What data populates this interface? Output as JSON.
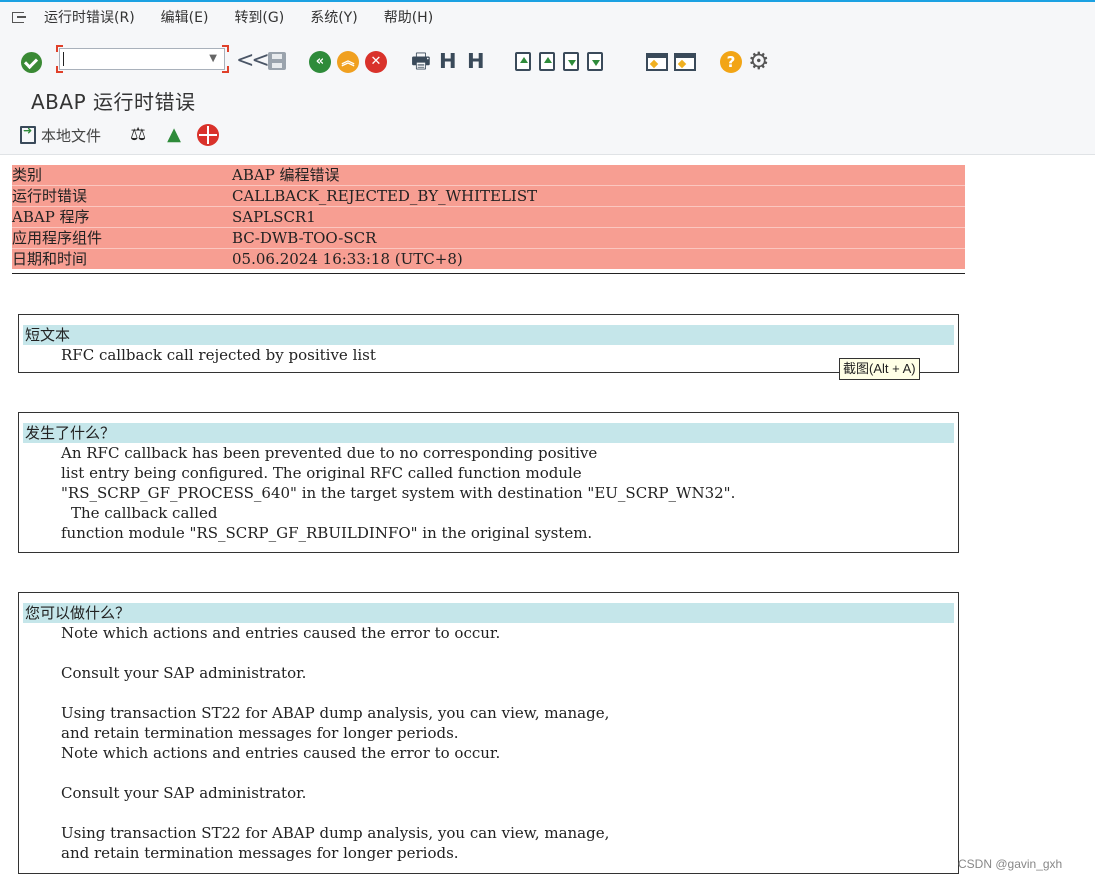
{
  "menu": {
    "items": [
      "运行时错误(R)",
      "编辑(E)",
      "转到(G)",
      "系统(Y)",
      "帮助(H)"
    ]
  },
  "toolbar": {
    "command_value": "",
    "icons": [
      "check-icon",
      "command-field",
      "double-left-icon",
      "save-icon",
      "back-icon",
      "exit-icon",
      "cancel-icon",
      "print-icon",
      "find-icon",
      "find-next-icon",
      "first-page-icon",
      "previous-page-icon",
      "next-page-icon",
      "last-page-icon",
      "new-session-icon",
      "shortcut-icon",
      "help-icon",
      "settings-icon"
    ]
  },
  "page": {
    "title": "ABAP 运行时错误",
    "local_file_label": "本地文件"
  },
  "header_table": [
    {
      "key": "类别",
      "value": "ABAP 编程错误"
    },
    {
      "key": "运行时错误",
      "value": "CALLBACK_REJECTED_BY_WHITELIST"
    },
    {
      "key": "ABAP 程序",
      "value": "SAPLSCR1"
    },
    {
      "key": "应用程序组件",
      "value": "BC-DWB-TOO-SCR"
    },
    {
      "key": "日期和时间",
      "value": "05.06.2024 16:33:18 (UTC+8)"
    }
  ],
  "sections": {
    "short_text": {
      "title": "短文本",
      "lines": [
        "RFC callback call rejected by positive list"
      ]
    },
    "what_happened": {
      "title": "发生了什么？",
      "lines": [
        "An RFC callback has been prevented due to no corresponding positive",
        "list entry being configured. The original RFC called function module",
        "\"RS_SCRP_GF_PROCESS_640\" in the target system with destination \"EU_SCRP_WN32\".",
        "The callback called",
        "function module \"RS_SCRP_GF_RBUILDINFO\" in the original system."
      ]
    },
    "what_to_do": {
      "title": "您可以做什么？",
      "lines": [
        "Note which actions and entries caused the error to occur.",
        "",
        "Consult your SAP administrator.",
        "",
        "Using transaction ST22 for ABAP dump analysis, you can view, manage,",
        "and retain termination messages for longer periods.",
        "Note which actions and entries caused the error to occur.",
        "",
        "Consult your SAP administrator.",
        "",
        "Using transaction ST22 for ABAP dump analysis, you can view, manage,",
        "and retain termination messages for longer periods."
      ]
    }
  },
  "tooltip": "截图(Alt + A)",
  "watermark": "CSDN @gavin_gxh",
  "colors": {
    "header_row_bg": "#f79e92",
    "section_title_bg": "#c5e6ea",
    "accent_line": "#1ba1e2"
  }
}
